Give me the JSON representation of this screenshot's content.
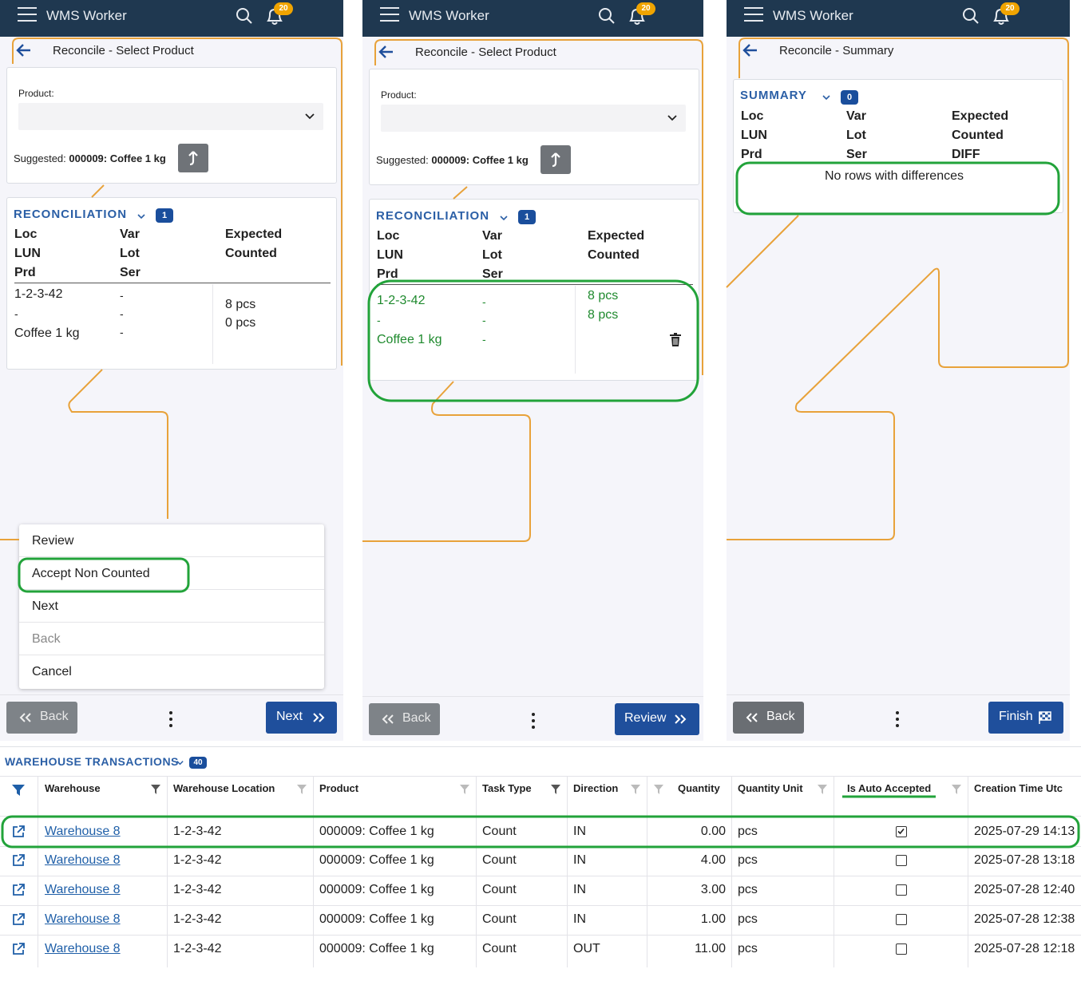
{
  "app": {
    "title": "WMS Worker",
    "notification_count": "20"
  },
  "panel1": {
    "page_title": "Reconcile - Select Product",
    "product_label": "Product:",
    "product_value": "",
    "suggested_label": "Suggested:",
    "suggested_value": "000009: Coffee 1 kg",
    "section_title": "RECONCILIATION",
    "section_count": "1",
    "headers": [
      "Loc",
      "Var",
      "Expected",
      "LUN",
      "Lot",
      "Counted",
      "Prd",
      "Ser"
    ],
    "row": {
      "loc": "1-2-3-42",
      "var": "-",
      "lun": "-",
      "lot": "-",
      "prd": "Coffee 1 kg",
      "ser": "-",
      "expected": "8 pcs",
      "counted": "0 pcs"
    },
    "menu": [
      "Review",
      "Accept Non Counted",
      "Next",
      "Back",
      "Cancel"
    ],
    "back_label": "Back",
    "next_label": "Next"
  },
  "panel2": {
    "page_title": "Reconcile - Select Product",
    "product_label": "Product:",
    "product_value": "",
    "suggested_label": "Suggested:",
    "suggested_value": "000009: Coffee 1 kg",
    "section_title": "RECONCILIATION",
    "section_count": "1",
    "headers": [
      "Loc",
      "Var",
      "Expected",
      "LUN",
      "Lot",
      "Counted",
      "Prd",
      "Ser"
    ],
    "row": {
      "loc": "1-2-3-42",
      "var": "-",
      "lun": "-",
      "lot": "-",
      "prd": "Coffee 1 kg",
      "ser": "-",
      "expected": "8 pcs",
      "counted": "8 pcs"
    },
    "back_label": "Back",
    "next_label": "Review"
  },
  "panel3": {
    "page_title": "Reconcile - Summary",
    "section_title": "SUMMARY",
    "section_count": "0",
    "headers": [
      "Loc",
      "Var",
      "Expected",
      "LUN",
      "Lot",
      "Counted",
      "Prd",
      "Ser",
      "DIFF"
    ],
    "empty_text": "No rows with differences",
    "back_label": "Back",
    "next_label": "Finish"
  },
  "grid": {
    "title": "WAREHOUSE TRANSACTIONS",
    "count": "40",
    "columns": [
      "Warehouse",
      "Warehouse Location",
      "Product",
      "Task Type",
      "Direction",
      "Quantity",
      "Quantity Unit",
      "Is Auto Accepted",
      "Creation Time Utc"
    ],
    "rows": [
      {
        "warehouse": "Warehouse 8",
        "location": "1-2-3-42",
        "product": "000009: Coffee 1 kg",
        "task": "Count",
        "direction": "IN",
        "quantity": "0.00",
        "unit": "pcs",
        "auto": true,
        "time": "2025-07-29 14:13"
      },
      {
        "warehouse": "Warehouse 8",
        "location": "1-2-3-42",
        "product": "000009: Coffee 1 kg",
        "task": "Count",
        "direction": "IN",
        "quantity": "4.00",
        "unit": "pcs",
        "auto": false,
        "time": "2025-07-28 13:18"
      },
      {
        "warehouse": "Warehouse 8",
        "location": "1-2-3-42",
        "product": "000009: Coffee 1 kg",
        "task": "Count",
        "direction": "IN",
        "quantity": "3.00",
        "unit": "pcs",
        "auto": false,
        "time": "2025-07-28 12:40"
      },
      {
        "warehouse": "Warehouse 8",
        "location": "1-2-3-42",
        "product": "000009: Coffee 1 kg",
        "task": "Count",
        "direction": "IN",
        "quantity": "1.00",
        "unit": "pcs",
        "auto": false,
        "time": "2025-07-28 12:38"
      },
      {
        "warehouse": "Warehouse 8",
        "location": "1-2-3-42",
        "product": "000009: Coffee 1 kg",
        "task": "Count",
        "direction": "OUT",
        "quantity": "11.00",
        "unit": "pcs",
        "auto": false,
        "time": "2025-07-28 12:18"
      }
    ]
  },
  "colors": {
    "accent": "#1f4f9c",
    "header": "#1f3850",
    "highlight": "#22a33a",
    "flow": "#e8a23a"
  }
}
